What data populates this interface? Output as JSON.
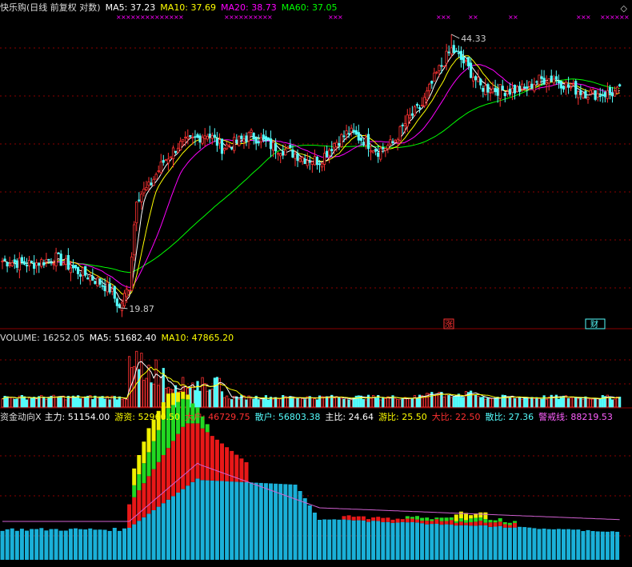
{
  "price_panel": {
    "title": "快乐购(日线 前复权 对数)",
    "ma5_label": "MA5: 37.23",
    "ma10_label": "MA10: 37.69",
    "ma20_label": "MA20: 38.73",
    "ma60_label": "MA60: 37.05",
    "high_label": "44.33",
    "low_label": "19.87",
    "tag_zhang": "涨",
    "tag_caibao": "财",
    "colors": {
      "ma5": "#ffffff",
      "ma10": "#ffff00",
      "ma20": "#ff00ff",
      "ma60": "#00ff00",
      "up": "#ff3232",
      "down": "#54fcfc",
      "grid": "#8b0000"
    }
  },
  "volume_panel": {
    "vol_label": "VOLUME: 16252.05",
    "ma5_label": "MA5: 51682.40",
    "ma10_label": "MA10: 47865.20"
  },
  "fund_panel": {
    "title": "资金动向X",
    "zhuli": "主力: 51154.00",
    "youzi": "游资: 52960.50",
    "dahu": "大户: 46729.75",
    "sanhu": "散户: 56803.38",
    "zhubi": "主比: 24.64",
    "youbi": "游比: 25.50",
    "dabi": "大比: 22.50",
    "sanbi": "散比: 27.36",
    "jingjie": "警戒线: 88219.53",
    "colors": {
      "base": "#1ab0d8",
      "red": "#e81818",
      "green": "#22d822",
      "yellow": "#f0f000",
      "line": "#d060d0"
    }
  },
  "chart_data": {
    "type": "candlestick",
    "scale": "log",
    "ylim": [
      19.0,
      47.0
    ],
    "marked_high": 44.33,
    "marked_low": 19.87,
    "ma": {
      "MA5": 37.23,
      "MA10": 37.69,
      "MA20": 38.73,
      "MA60": 37.05
    },
    "volume": {
      "VOLUME": 16252.05,
      "MA5": 51682.4,
      "MA10": 47865.2
    },
    "fund_flow": {
      "主力": 51154.0,
      "游资": 52960.5,
      "大户": 46729.75,
      "散户": 56803.38,
      "主比": 24.64,
      "游比": 25.5,
      "大比": 22.5,
      "散比": 27.36,
      "警戒线": 88219.53
    },
    "anchors": [
      [
        0,
        22.8
      ],
      [
        12,
        22.6
      ],
      [
        22,
        23.0
      ],
      [
        30,
        22.2
      ],
      [
        38,
        21.6
      ],
      [
        44,
        21.0
      ],
      [
        48,
        19.9
      ],
      [
        52,
        21.2
      ],
      [
        55,
        27.5
      ],
      [
        60,
        28.3
      ],
      [
        66,
        30.5
      ],
      [
        72,
        32.0
      ],
      [
        78,
        32.5
      ],
      [
        84,
        33.2
      ],
      [
        90,
        31.8
      ],
      [
        96,
        32.3
      ],
      [
        102,
        33.0
      ],
      [
        110,
        32.0
      ],
      [
        118,
        31.4
      ],
      [
        124,
        30.8
      ],
      [
        130,
        30.6
      ],
      [
        136,
        32.2
      ],
      [
        142,
        33.3
      ],
      [
        148,
        32.5
      ],
      [
        154,
        31.5
      ],
      [
        160,
        32.2
      ],
      [
        166,
        34.5
      ],
      [
        172,
        36.0
      ],
      [
        178,
        39.5
      ],
      [
        184,
        42.5
      ],
      [
        190,
        40.5
      ],
      [
        196,
        38.0
      ],
      [
        202,
        37.7
      ],
      [
        208,
        37.6
      ],
      [
        214,
        37.8
      ],
      [
        220,
        38.8
      ],
      [
        226,
        39.0
      ],
      [
        232,
        38.0
      ],
      [
        238,
        37.4
      ],
      [
        244,
        37.2
      ],
      [
        249,
        37.3
      ],
      [
        253,
        37.5
      ]
    ]
  }
}
